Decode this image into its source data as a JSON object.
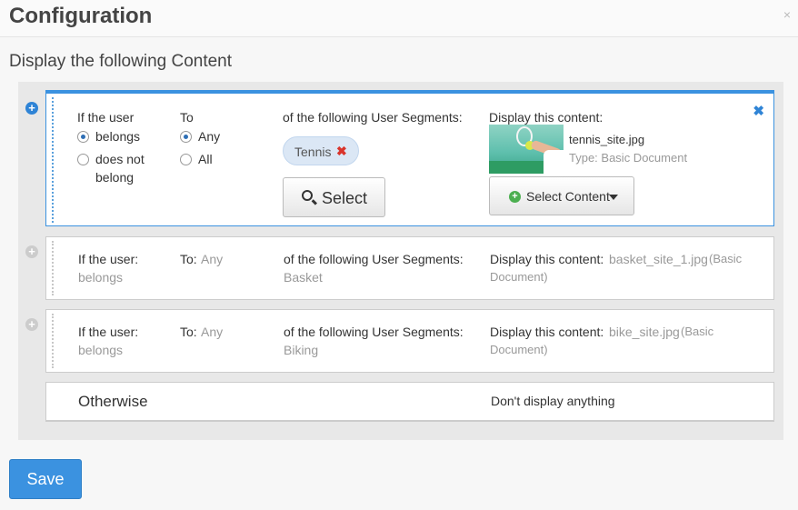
{
  "header": {
    "title": "Configuration",
    "close_label": "×"
  },
  "subtitle": "Display the following Content",
  "active_rule": {
    "if_user_label": "If the user",
    "belongs_option": "belongs",
    "not_belong_line1": "does not",
    "not_belong_line2": "belong",
    "to_label": "To",
    "any_option": "Any",
    "all_option": "All",
    "segments_label": "of the following User Segments:",
    "segment_tag": "Tennis",
    "tag_remove": "✖",
    "select_label": "Select",
    "display_label": "Display this content:",
    "content_name": "tennis_site.jpg",
    "content_type": "Type: Basic Document",
    "select_content_label": "Select Content",
    "close_label": "✖",
    "membership_selected": "belongs",
    "match_selected": "Any"
  },
  "rules": [
    {
      "if_label": "If the user:",
      "membership": "belongs",
      "to_label": "To:",
      "to_value": "Any",
      "segments_label": "of the following User Segments:",
      "segment": "Basket",
      "display_label": "Display this content:",
      "content_name": "basket_site_1.jpg",
      "content_type_1": "(Basic",
      "content_type_2": "Document)"
    },
    {
      "if_label": "If the user:",
      "membership": "belongs",
      "to_label": "To:",
      "to_value": "Any",
      "segments_label": "of the following User Segments:",
      "segment": "Biking",
      "display_label": "Display this content:",
      "content_name": "bike_site.jpg",
      "content_type_1": "(Basic",
      "content_type_2": "Document)"
    }
  ],
  "otherwise": {
    "label": "Otherwise",
    "action": "Don't display anything"
  },
  "save_label": "Save",
  "icons": {
    "add": "plus-circle-icon",
    "search": "search-icon",
    "add_content": "plus-circle-green-icon",
    "caret": "caret-down-icon",
    "remove": "close-icon"
  },
  "colors": {
    "accent": "#3b92e0",
    "remove": "#d9342b",
    "tag_bg": "#dbe7f5"
  }
}
